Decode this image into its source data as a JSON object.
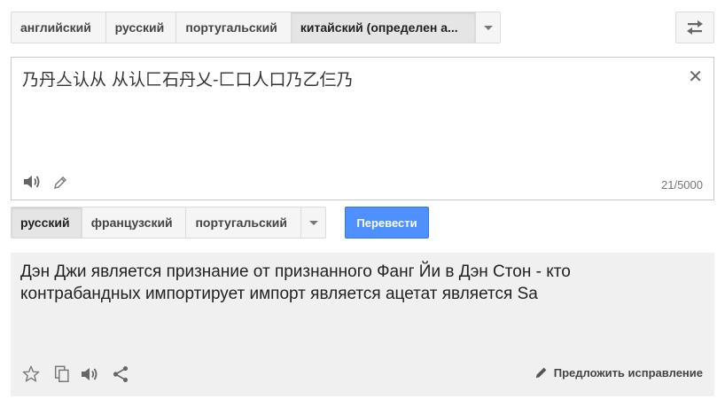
{
  "source_languages": {
    "items": [
      "английский",
      "русский",
      "португальский",
      "китайский (определен а..."
    ],
    "selected_index": 3
  },
  "source": {
    "text": "乃丹亼认从 从认匚石丹乂-匚口人口乃乙仨乃",
    "char_count": "21/5000"
  },
  "target_languages": {
    "items": [
      "русский",
      "французский",
      "португальский"
    ],
    "selected_index": 0
  },
  "translate_button": "Перевести",
  "result": {
    "text": "Дэн Джи является признание от признанного Фанг Йи в Дэн Стон - кто контрабандных импортирует импорт является ацетат является Sa",
    "suggest_edit": "Предложить исправление"
  }
}
